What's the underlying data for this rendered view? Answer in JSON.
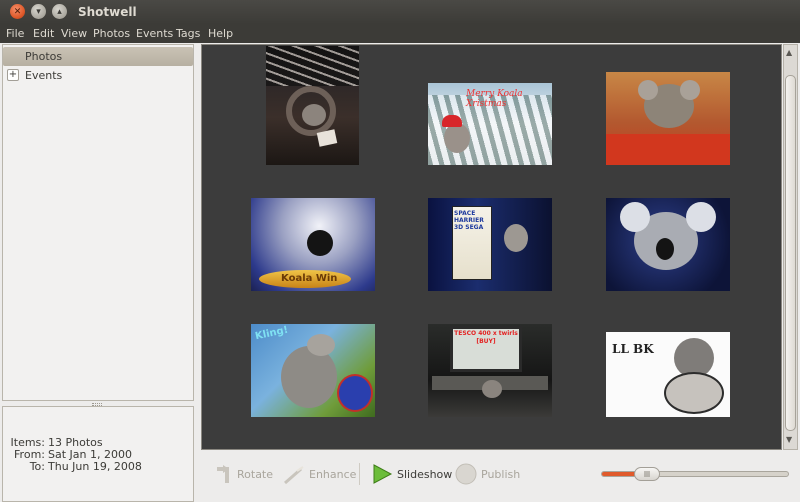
{
  "window": {
    "title": "Shotwell"
  },
  "menubar": {
    "items": [
      "File",
      "Edit",
      "View",
      "Photos",
      "Events",
      "Tags",
      "Help"
    ]
  },
  "sidebar": {
    "items": [
      {
        "label": "Photos",
        "selected": true
      },
      {
        "label": "Events",
        "expander": "+"
      }
    ]
  },
  "stats": {
    "items_label": "Items:",
    "items_value": "13 Photos",
    "from_label": "From:",
    "from_value": "Sat Jan 1, 2000",
    "to_label": "To:",
    "to_value": "Thu Jun 19, 2008"
  },
  "photos": [
    {
      "caption_text": "",
      "theme": "collage-dark"
    },
    {
      "caption_text": "Merry Koala Xristmas",
      "theme": "snow"
    },
    {
      "caption_text": "",
      "theme": "orange-room"
    },
    {
      "caption_text": "Koala Win",
      "theme": "blue-closeup"
    },
    {
      "caption_text": "SPACE HARRIER 3D SEGA",
      "theme": "game-box"
    },
    {
      "caption_text": "",
      "theme": "dark-blue"
    },
    {
      "caption_text": "Kling!",
      "theme": "koala-sticker"
    },
    {
      "caption_text": "TESCO 400 x twirls [BUY]",
      "theme": "monitor"
    },
    {
      "caption_text": "LL BK",
      "theme": "drawing"
    }
  ],
  "toolbar": {
    "rotate": "Rotate",
    "enhance": "Enhance",
    "slideshow": "Slideshow",
    "publish": "Publish",
    "zoom_level": 0.2
  },
  "colors": {
    "accent": "#e05a2b",
    "viewport_bg": "#3c3c3c",
    "selected_row": "#bdb6a8"
  }
}
